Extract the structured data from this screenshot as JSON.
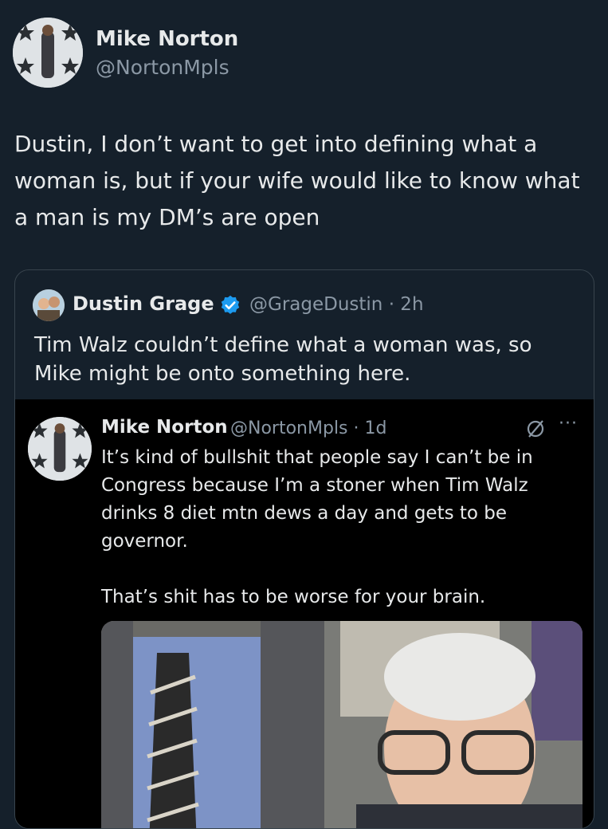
{
  "post": {
    "author_name": "Mike Norton",
    "author_handle": "@NortonMpls",
    "avatar_icon": "star-collage-avatar",
    "text": "Dustin, I don’t want to get into defining what a woman is, but if your wife would like to know what a man is my DM’s are open"
  },
  "quote": {
    "author_name": "Dustin Grage",
    "verified_icon": "verified-badge-icon",
    "handle_time": "@GrageDustin · 2h",
    "text": "Tim Walz couldn’t define what a woman was, so Mike might be onto something here."
  },
  "embedded": {
    "author_name": "Mike Norton",
    "handle_time": "@NortonMpls · 1d",
    "paragraph1": "It’s kind of bullshit that people say I can’t be in Congress because I’m a stoner when Tim Walz drinks 8 diet mtn dews a day and gets to be governor.",
    "paragraph2": "That’s shit has to be worse for your brain.",
    "more_label": "···"
  },
  "colors": {
    "background": "#15202b",
    "verified": "#1d9bf0",
    "secondary_text": "#8b98a5"
  }
}
